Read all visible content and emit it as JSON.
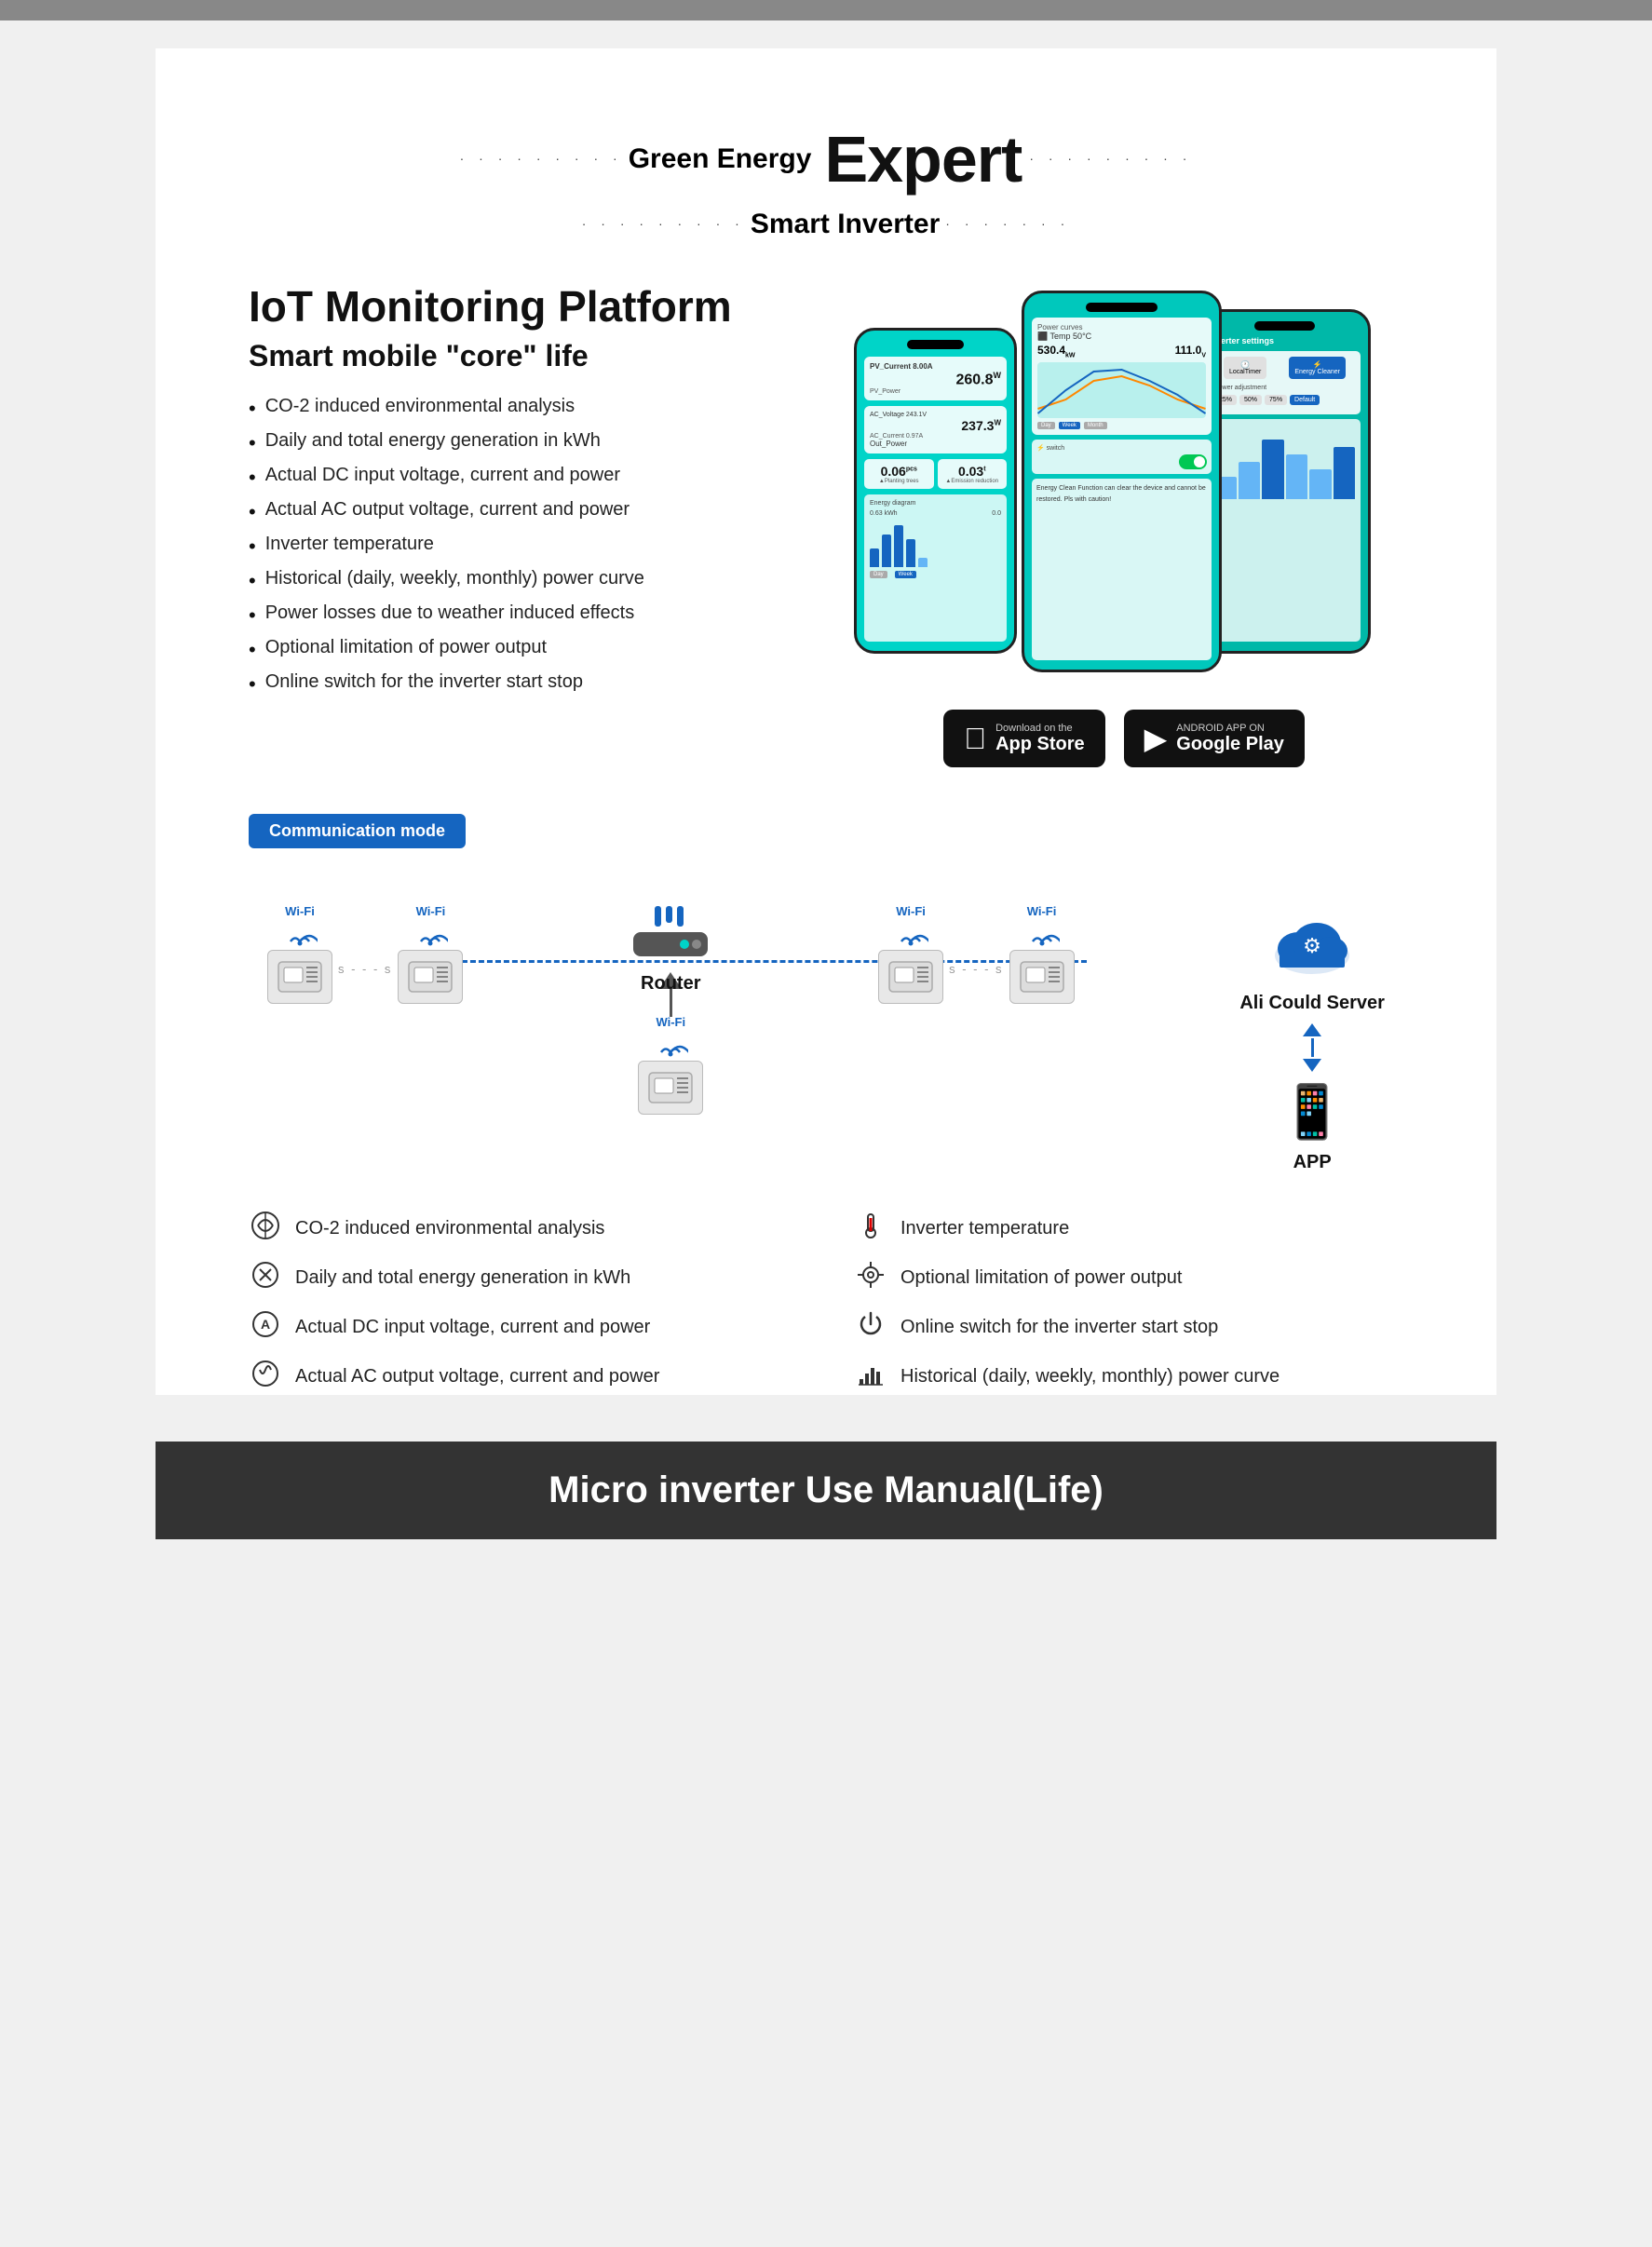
{
  "header": {
    "line1_dots_left": "· · · · · · · · ·",
    "line1_text": "Green Energy",
    "line1_dots_right": "· · · · · · · · ·",
    "line2_dots_left": "· · · · · · · · ·",
    "line2_text": "Smart Inverter",
    "expert_label": "Expert",
    "line2_dots_right": "· · · · · · ·"
  },
  "iot": {
    "title": "IoT Monitoring Platform",
    "subtitle": "Smart mobile \"core\" life",
    "features": [
      "CO-2 induced environmental analysis",
      "Daily and total energy generation in kWh",
      "Actual DC input voltage, current and power",
      "Actual AC output voltage, current and power",
      "Inverter temperature",
      "Historical (daily, weekly, monthly) power curve",
      "Power losses due to weather induced effects",
      "Optional limitation of power output",
      "Online switch for the inverter start stop"
    ]
  },
  "appstore": {
    "apple_label_small": "Download on the",
    "apple_label_big": "App Store",
    "google_label_small": "ANDROID APP ON",
    "google_label_big": "Google Play"
  },
  "communication": {
    "badge": "Communication mode",
    "router_label": "Router",
    "cloud_label": "Ali Could Server",
    "app_label": "APP"
  },
  "features_bottom": [
    {
      "icon": "♻",
      "text": "CO-2 induced environmental analysis"
    },
    {
      "icon": "🌡",
      "text": "Inverter temperature"
    },
    {
      "icon": "⚙",
      "text": "Daily and total energy generation in kWh"
    },
    {
      "icon": "⚙",
      "text": "Optional limitation of power output"
    },
    {
      "icon": "Ⓐ",
      "text": "Actual DC input voltage, current and power"
    },
    {
      "icon": "⏻",
      "text": "Online switch for the inverter start stop"
    },
    {
      "icon": "✓",
      "text": "Actual AC output voltage, current and power"
    },
    {
      "icon": "📊",
      "text": "Historical (daily, weekly, monthly) power curve"
    }
  ],
  "footer": {
    "text": "Micro inverter Use Manual(Life)"
  }
}
